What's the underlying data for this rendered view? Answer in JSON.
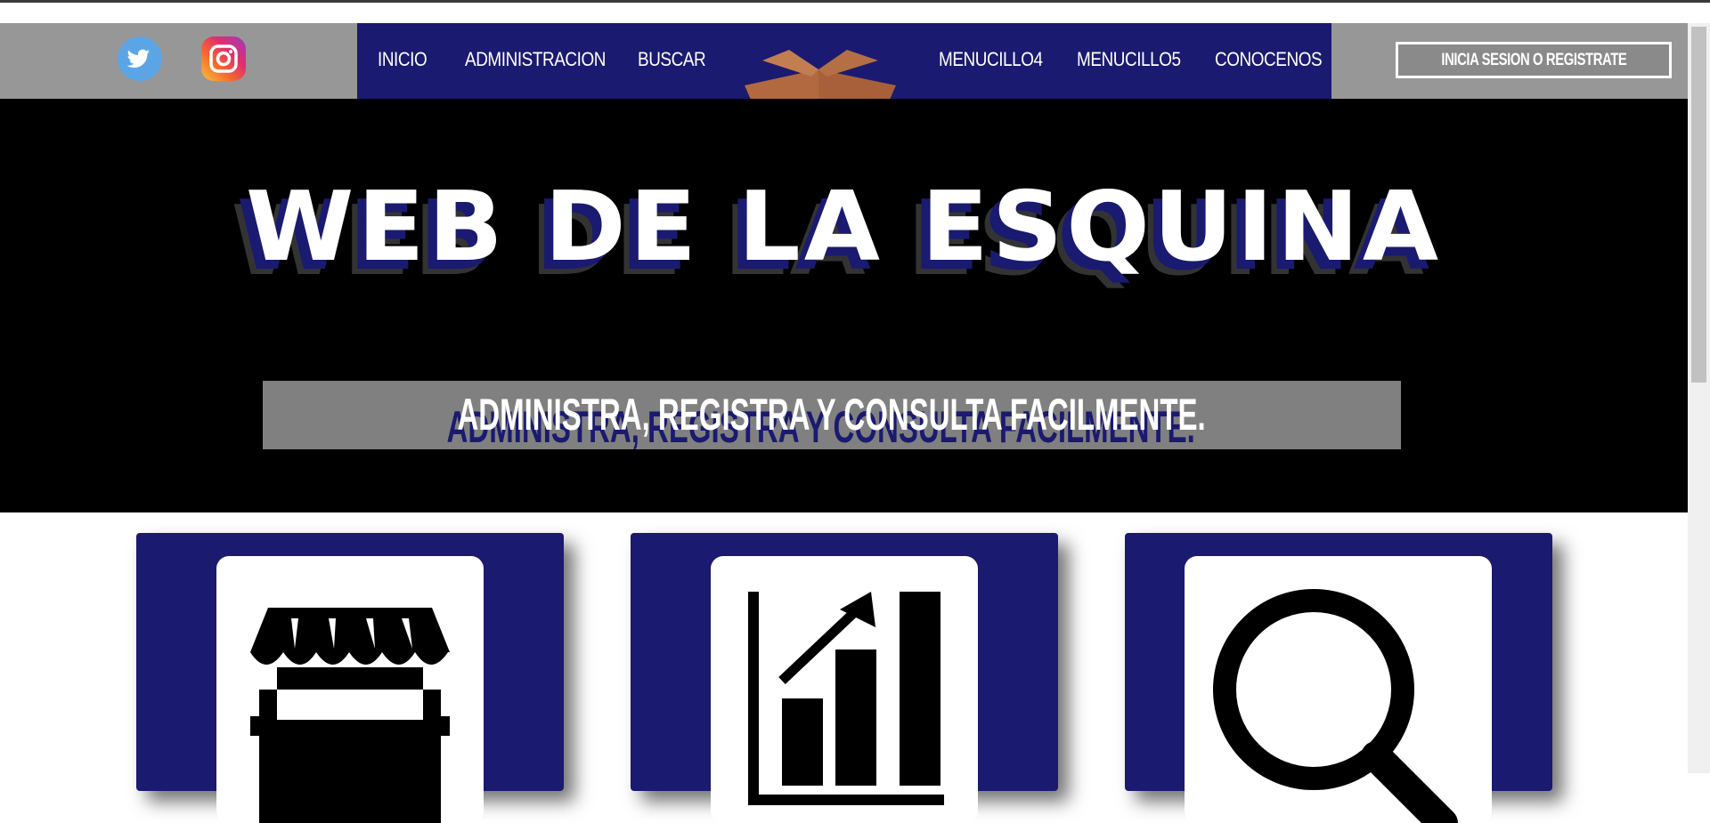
{
  "nav": {
    "items": [
      "INICIO",
      "ADMINISTRACION",
      "BUSCAR",
      "MENUCILLO4",
      "MENUCILLO5",
      "CONOCENOS"
    ]
  },
  "auth": {
    "login_label": "INICIA SESION O REGISTRATE"
  },
  "hero": {
    "title": "WEB DE LA ESQUINA",
    "subtitle": "ADMINISTRA, REGISTRA Y CONSULTA FACILMENTE."
  },
  "social": {
    "icons": [
      "twitter-icon",
      "instagram-icon"
    ]
  },
  "cards": [
    {
      "icon": "store-icon"
    },
    {
      "icon": "bar-chart-icon"
    },
    {
      "icon": "search-icon"
    }
  ],
  "colors": {
    "navy": "#1a1a70",
    "header_gray": "#979797",
    "hero_bg": "#000000",
    "subtitle_gray": "#808080"
  }
}
